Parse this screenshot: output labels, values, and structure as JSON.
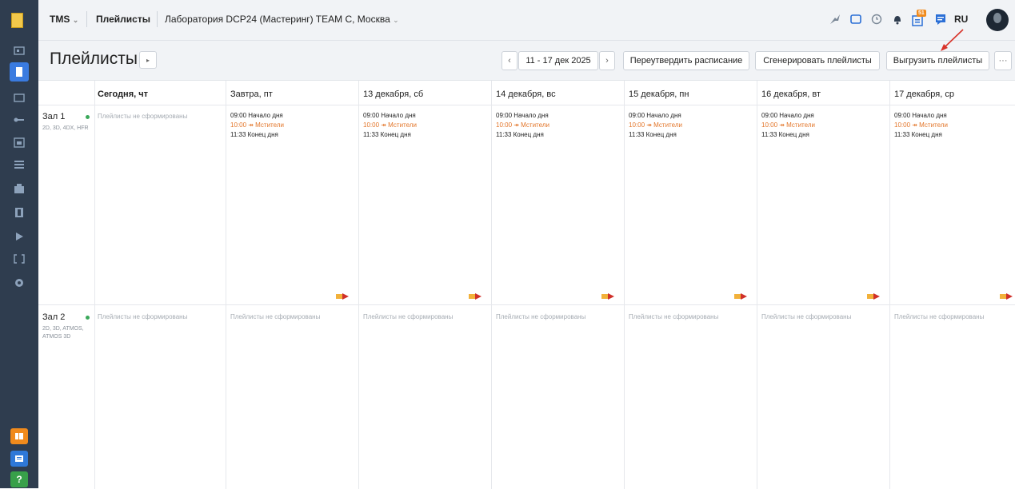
{
  "topbar": {
    "app": "TMS",
    "section": "Плейлисты",
    "context": "Лаборатория DCP24 (Мастеринг) TEAM C, Москва",
    "notif_badge": "51",
    "lang": "RU"
  },
  "header": {
    "title": "Плейлисты",
    "date_range": "11 - 17 дек 2025",
    "reapprove_label": "Переутвердить расписание",
    "generate_label": "Сгенерировать плейлисты",
    "export_label": "Выгрузить плейлисты",
    "more_label": "···"
  },
  "days": [
    "Сегодня, чт",
    "Завтра, пт",
    "13 декабря, сб",
    "14 декабря, вс",
    "15 декабря, пн",
    "16 декабря, вт",
    "17 декабря, ср"
  ],
  "halls": [
    {
      "name": "Зал 1",
      "formats": "2D, 3D, 4DX, HFR"
    },
    {
      "name": "Зал 2",
      "formats": "2D, 3D, ATMOS, ATMOS 3D"
    }
  ],
  "empty_text": "Плейлисты не сформированы",
  "events": {
    "start": "09:00 Начало дня",
    "show": "10:00 ↠ Мстители",
    "end": "11:33 Конец дня"
  }
}
